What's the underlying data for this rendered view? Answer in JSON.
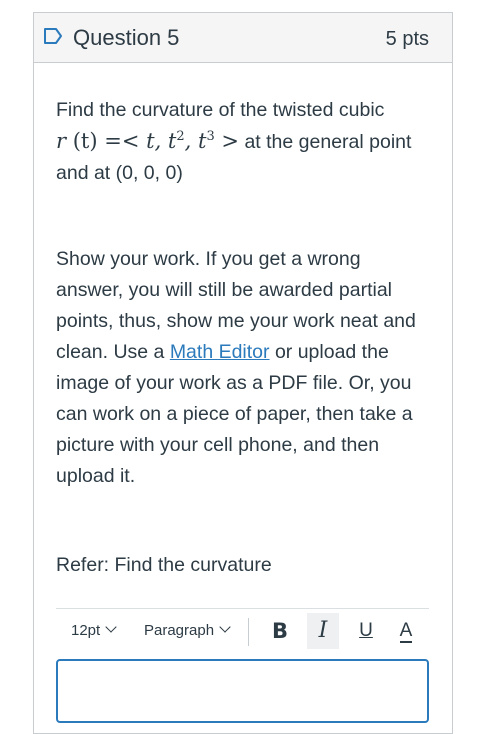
{
  "question": {
    "title": "Question 5",
    "points": "5 pts"
  },
  "body": {
    "p1_before": "Find the curvature of the twisted cubic",
    "p1_math_r": "r",
    "p1_math_t": "(t)",
    "p1_math_eq": " =< ",
    "p1_math_t1": "t",
    "p1_math_t2": "t",
    "p1_math_exp2": "2",
    "p1_math_t3": "t",
    "p1_math_exp3": "3",
    "p1_math_gt": " >",
    "p1_after": " at the general point and at (0, 0, 0)",
    "p2_before": "Show your work. If you get a wrong answer, you will still be awarded partial points, thus, show me your work neat and clean.  Use a ",
    "p2_link": "Math Editor",
    "p2_after": " or upload the image of your work as a PDF file. Or, you can work on a piece of paper, then take a picture with your cell phone, and then upload it.",
    "p3": "Refer: Find the curvature"
  },
  "toolbar": {
    "font_size": "12pt",
    "format": "Paragraph",
    "bold_label": "B",
    "italic_label": "I",
    "underline_label": "U",
    "color_label": "A"
  },
  "colors": {
    "accent": "#2b7abc",
    "text": "#2d3b45",
    "header_bg": "#f5f5f5"
  },
  "icons": {
    "flag": "flag-outline-icon"
  }
}
